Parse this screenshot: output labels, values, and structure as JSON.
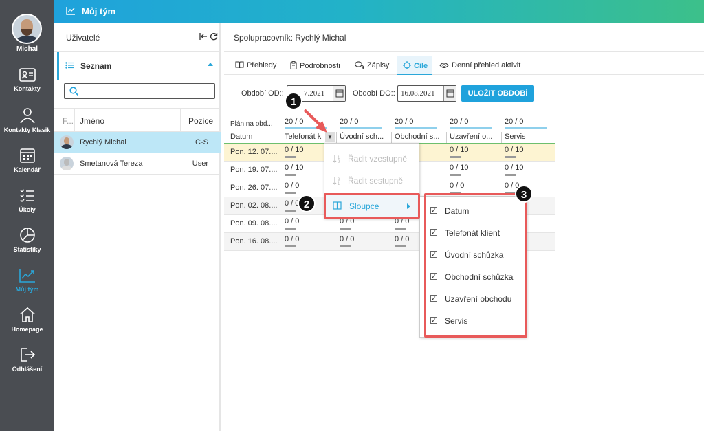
{
  "nav": {
    "user_name": "Michal",
    "items": [
      {
        "label": "Kontakty",
        "icon": "contact-card-icon"
      },
      {
        "label": "Kontakty Klasik",
        "icon": "person-icon"
      },
      {
        "label": "Kalendář",
        "icon": "calendar-icon"
      },
      {
        "label": "Úkoly",
        "icon": "checklist-icon"
      },
      {
        "label": "Statistiky",
        "icon": "pie-chart-icon"
      },
      {
        "label": "Můj tým",
        "icon": "trend-chart-icon"
      },
      {
        "label": "Homepage",
        "icon": "home-icon"
      },
      {
        "label": "Odhlášení",
        "icon": "logout-icon"
      }
    ],
    "active_color": "#2aa7d9"
  },
  "topbar": {
    "title": "Můj tým"
  },
  "users": {
    "title": "Uživatelé",
    "tab_label": "Seznam",
    "search_placeholder": "",
    "columns": {
      "f": "F...",
      "name": "Jméno",
      "position": "Pozice"
    },
    "rows": [
      {
        "name": "Rychlý Michal",
        "position": "C-S"
      },
      {
        "name": "Smetanová Tereza",
        "position": "User"
      }
    ]
  },
  "main": {
    "title": "Spolupracovník: Rychlý Michal",
    "tabs": [
      "Přehledy",
      "Podrobnosti",
      "Zápisy",
      "Cíle",
      "Denní přehled aktivit"
    ],
    "period_from_label": "Období OD::",
    "period_from_value": "7.2021",
    "period_to_label": "Období DO::",
    "period_to_value": "16.08.2021",
    "save_button": "ULOŽIT OBDOBÍ",
    "plan_label": "Plán na obd...",
    "plan_values": [
      "20 / 0",
      "20 / 0",
      "20 / 0",
      "20 / 0",
      "20 / 0"
    ],
    "columns": [
      "Datum",
      "Telefonát k",
      "Úvodní sch...",
      "Obchodní s...",
      "Uzavření o...",
      "Servis"
    ],
    "rows": [
      {
        "date": "Pon. 12. 07....",
        "cells": [
          "0 / 10",
          "",
          "",
          "0 / 10",
          "0 / 10"
        ]
      },
      {
        "date": "Pon. 19. 07....",
        "cells": [
          "0 / 10",
          "",
          "",
          "0 / 10",
          "0 / 10"
        ]
      },
      {
        "date": "Pon. 26. 07....",
        "cells": [
          "0 / 0",
          "",
          "",
          "0 / 0",
          "0 / 0"
        ]
      },
      {
        "date": "Pon. 02. 08....",
        "cells": [
          "0 / 0",
          "",
          "",
          "",
          ""
        ]
      },
      {
        "date": "Pon. 09. 08....",
        "cells": [
          "0 / 0",
          "0 / 0",
          "0 / 0",
          "",
          ""
        ]
      },
      {
        "date": "Pon. 16. 08....",
        "cells": [
          "0 / 0",
          "0 / 0",
          "0 / 0",
          "",
          ""
        ]
      }
    ]
  },
  "menu": {
    "items": [
      "Řadit vzestupně",
      "Řadit sestupně",
      "Sloupce"
    ]
  },
  "submenu": {
    "items": [
      "Datum",
      "Telefonát klient",
      "Úvodní schůzka",
      "Obchodní schůzka",
      "Uzavření obchodu",
      "Servis"
    ]
  },
  "badges": [
    "1",
    "2",
    "3"
  ]
}
